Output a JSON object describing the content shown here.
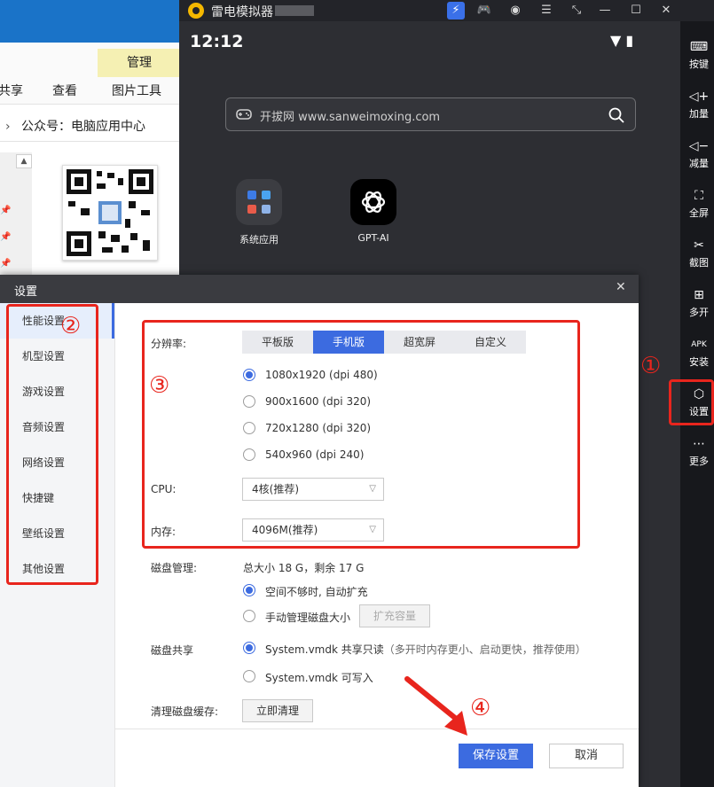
{
  "explorer": {
    "ribbon": {
      "manage_tab": "管理",
      "tabs": [
        "共享",
        "查看",
        "图片工具"
      ]
    },
    "address": {
      "chevron": "›",
      "path": "公众号：电脑应用中心"
    }
  },
  "emulator": {
    "title": "雷电模拟器",
    "titlebar_icons": [
      "boost-icon",
      "gamepad-icon",
      "account-icon",
      "menu-icon",
      "expand-icon",
      "minimize-icon",
      "maximize-icon",
      "close-icon"
    ],
    "status": {
      "time": "12:12"
    },
    "search": {
      "placeholder": "开拔网 www.sanweimoxing.com"
    },
    "apps": [
      {
        "label": "系统应用",
        "icon": "system-apps-icon"
      },
      {
        "label": "GPT-AI",
        "icon": "gpt-ai-icon"
      }
    ],
    "sidebar": [
      {
        "label": "按键",
        "icon": "keyboard-icon"
      },
      {
        "label": "加量",
        "icon": "volume-up-icon"
      },
      {
        "label": "减量",
        "icon": "volume-down-icon"
      },
      {
        "label": "全屏",
        "icon": "fullscreen-icon"
      },
      {
        "label": "截图",
        "icon": "scissors-icon"
      },
      {
        "label": "多开",
        "icon": "multi-instance-icon"
      },
      {
        "label": "安装",
        "icon": "apk-icon"
      },
      {
        "label": "设置",
        "icon": "gear-icon"
      },
      {
        "label": "更多",
        "icon": "more-icon"
      }
    ]
  },
  "settings": {
    "title": "设置",
    "nav": [
      "性能设置",
      "机型设置",
      "游戏设置",
      "音频设置",
      "网络设置",
      "快捷键",
      "壁纸设置",
      "其他设置"
    ],
    "active_nav": "性能设置",
    "resolution": {
      "label": "分辨率:",
      "tabs": [
        "平板版",
        "手机版",
        "超宽屏",
        "自定义"
      ],
      "active_tab": "手机版",
      "options": [
        {
          "res": "1080x1920",
          "dpi": "(dpi 480)",
          "selected": true
        },
        {
          "res": "900x1600",
          "dpi": "(dpi 320)",
          "selected": false
        },
        {
          "res": "720x1280",
          "dpi": "(dpi 320)",
          "selected": false
        },
        {
          "res": "540x960",
          "dpi": "(dpi 240)",
          "selected": false
        }
      ]
    },
    "cpu": {
      "label": "CPU:",
      "value": "4核(推荐)"
    },
    "memory": {
      "label": "内存:",
      "value": "4096M(推荐)"
    },
    "disk": {
      "label": "磁盘管理:",
      "info": "总大小 18 G，剩余 17 G",
      "auto_expand": "空间不够时, 自动扩充",
      "manual": "手动管理磁盘大小",
      "expand_button": "扩充容量"
    },
    "disk_share": {
      "label": "磁盘共享",
      "readonly": "System.vmdk 共享只读",
      "readonly_hint": "（多开时内存更小、启动更快，推荐使用）",
      "writable": "System.vmdk 可写入"
    },
    "clear_cache": {
      "label": "清理磁盘缓存:",
      "button": "立即清理"
    },
    "save_button": "保存设置",
    "cancel_button": "取消"
  },
  "annotations": {
    "marks": [
      "①",
      "②",
      "③",
      "④"
    ],
    "color": "#e8251d"
  }
}
